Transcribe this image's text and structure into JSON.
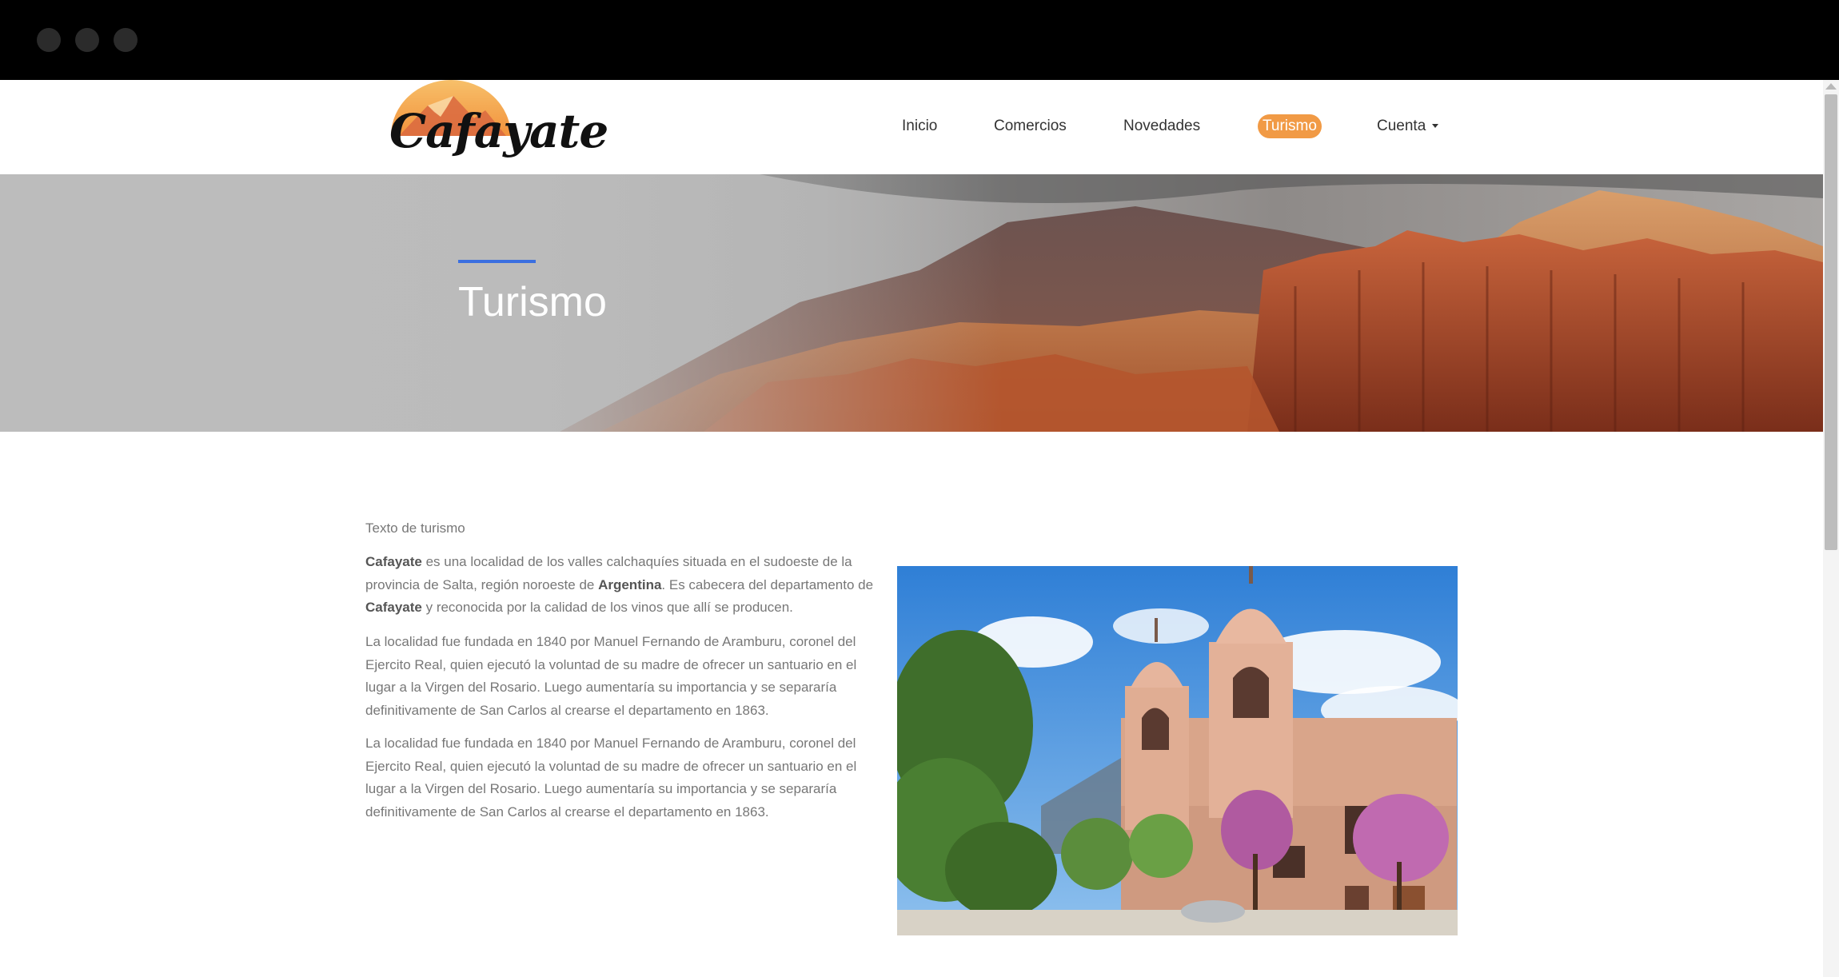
{
  "window": {
    "controls": [
      "close",
      "minimize",
      "maximize"
    ]
  },
  "logo": {
    "text": "Cafayate",
    "colors": {
      "sun": "#f2a34a",
      "sun_light": "#f7c06a",
      "mountain": "#c85a3a"
    }
  },
  "nav": {
    "items": [
      {
        "label": "Inicio",
        "active": false
      },
      {
        "label": "Comercios",
        "active": false
      },
      {
        "label": "Novedades",
        "active": false
      },
      {
        "label": "Turismo",
        "active": true
      },
      {
        "label": "Cuenta",
        "active": false,
        "has_dropdown": true
      }
    ],
    "active_color": "#f19a45"
  },
  "hero": {
    "title": "Turismo",
    "accent_color": "#3b6fe0"
  },
  "content": {
    "intro": "Texto de turismo",
    "paragraph1": {
      "bold1": "Cafayate",
      "text1": " es una localidad de los valles calchaquíes situada en el sudoeste de la provincia de Salta, región noroeste de ",
      "bold2": "Argentina",
      "text2": ". Es cabecera del departamento de ",
      "bold3": "Cafayate",
      "text3": " y reconocida por la calidad de los vinos que allí se producen."
    },
    "paragraph2": "La localidad fue fundada en 1840 por Manuel Fernando de Aramburu, coronel del Ejercito Real, quien ejecutó la voluntad de su madre de ofrecer un santuario en el lugar a la Virgen del Rosario. Luego aumentaría su importancia y se separaría definitivamente de San Carlos al crearse el departamento en 1863.",
    "paragraph3": "La localidad fue fundada en 1840 por Manuel Fernando de Aramburu, coronel del Ejercito Real, quien ejecutó la voluntad de su madre de ofrecer un santuario en el lugar a la Virgen del Rosario. Luego aumentaría su importancia y se separaría definitivamente de San Carlos al crearse el departamento en 1863."
  }
}
